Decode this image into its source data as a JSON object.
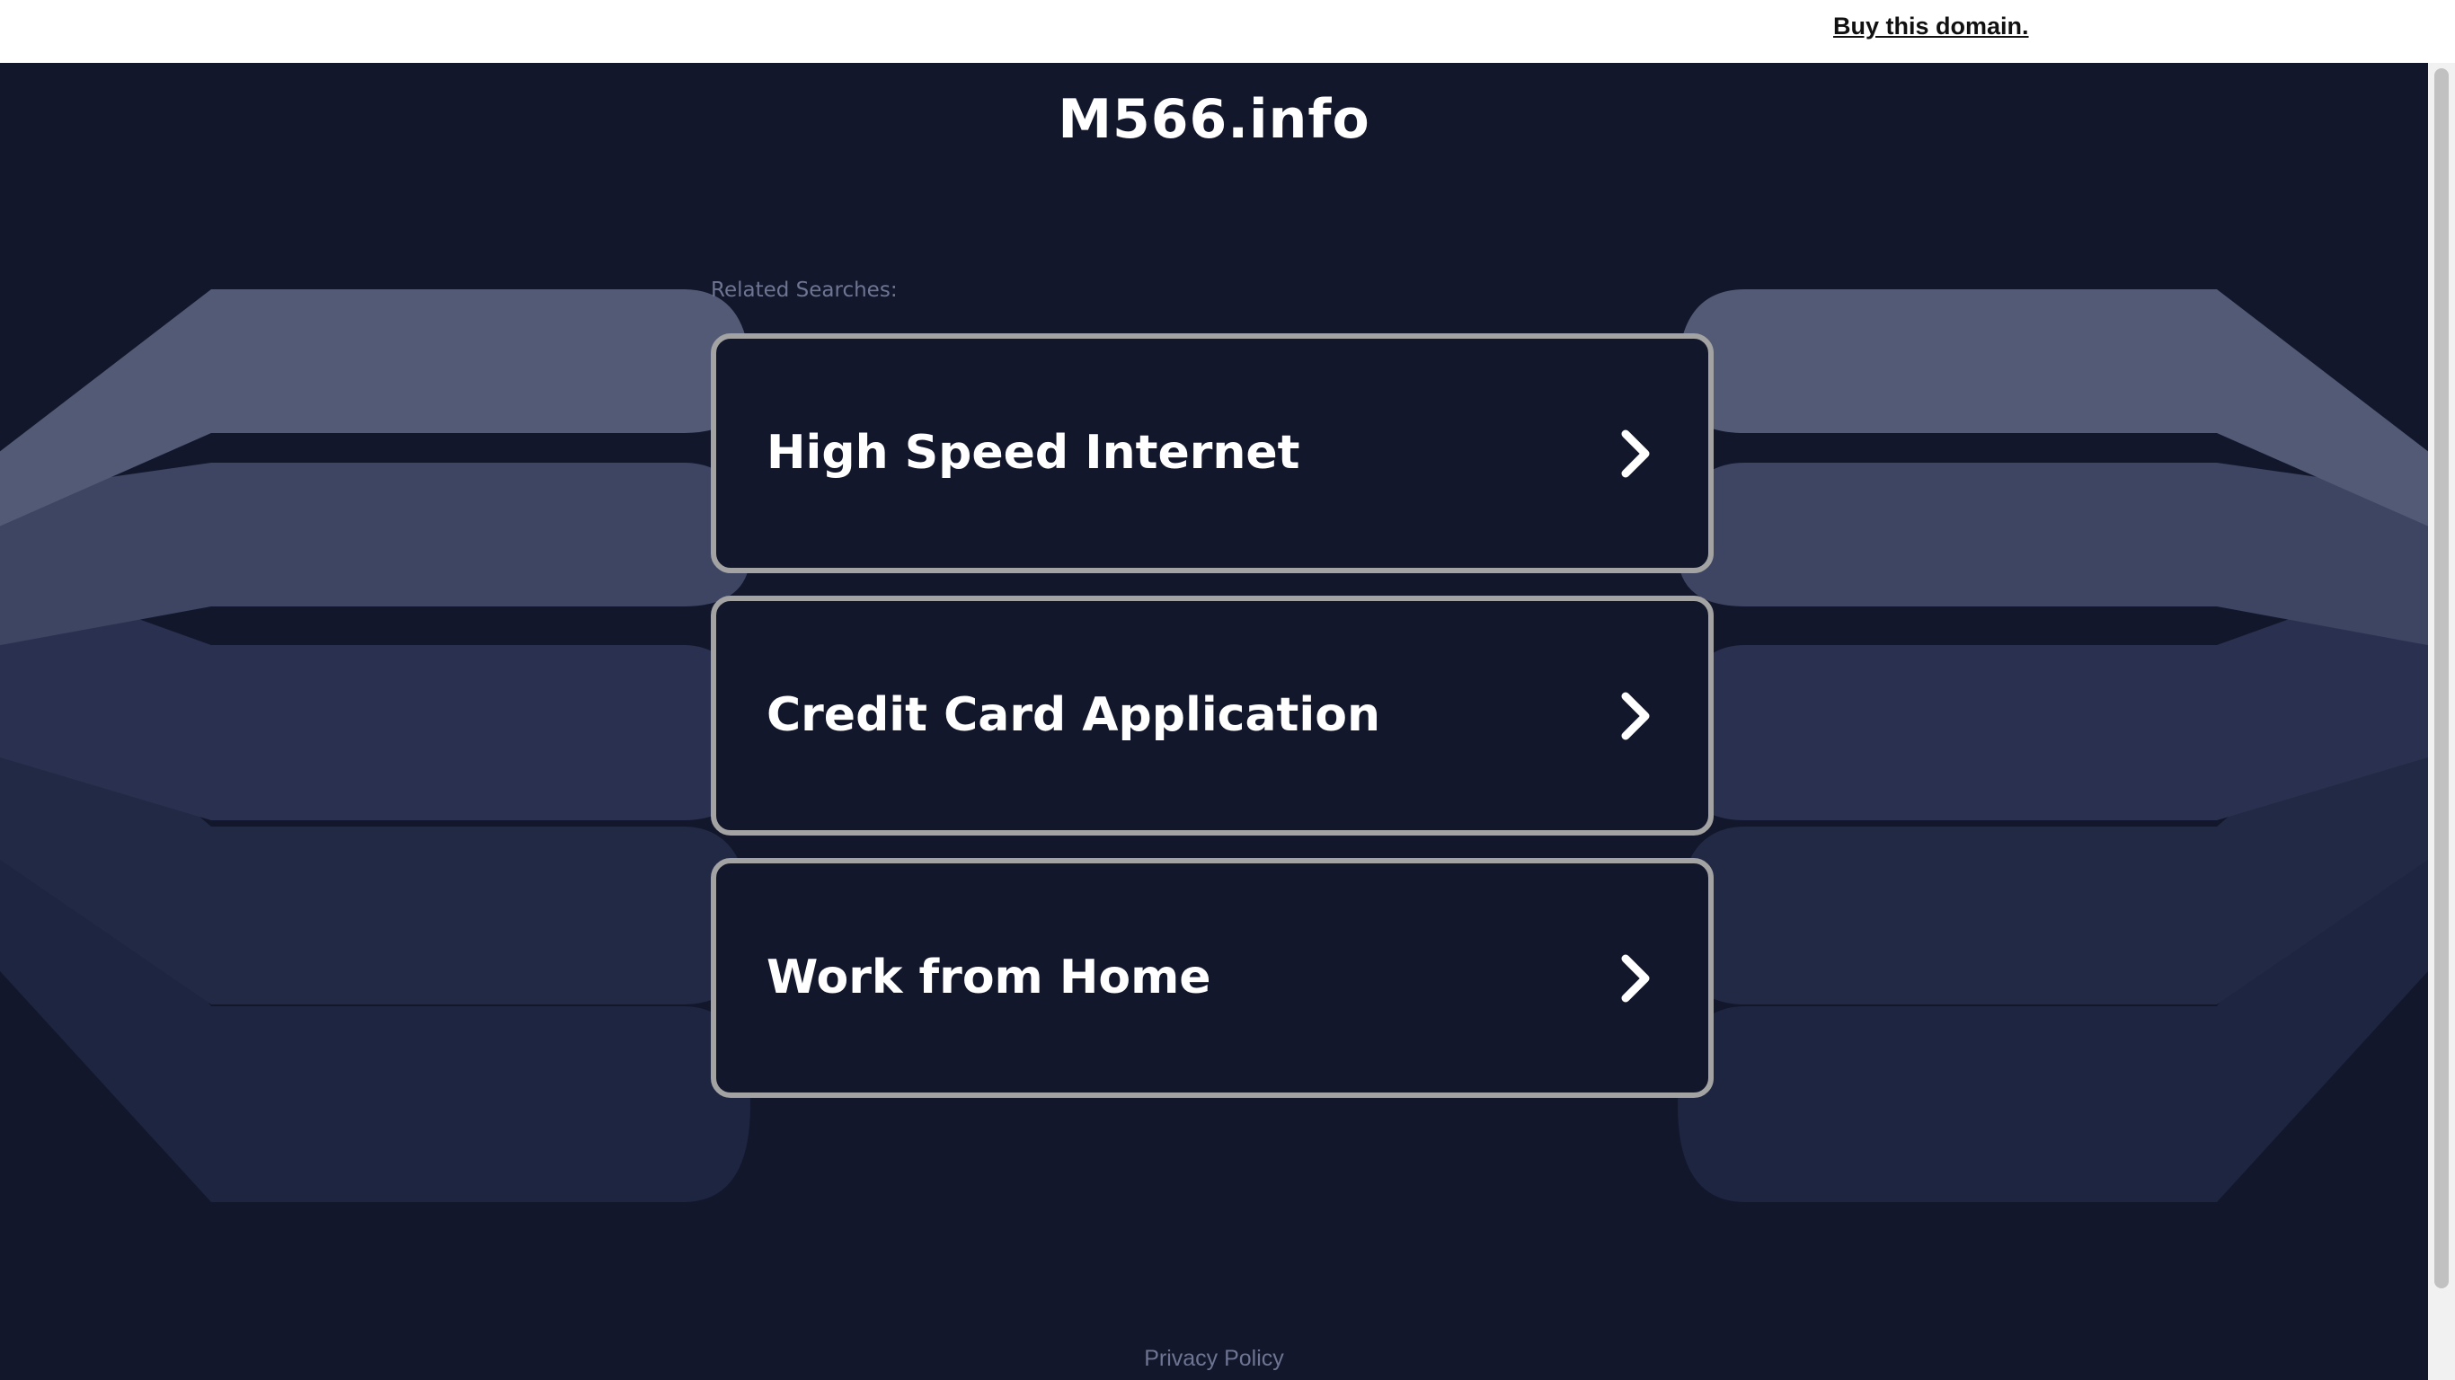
{
  "topbar": {
    "buy_link": "Buy this domain."
  },
  "page": {
    "title": "M566.info",
    "related_label": "Related Searches:"
  },
  "results": [
    {
      "label": "High Speed Internet"
    },
    {
      "label": "Credit Card Application"
    },
    {
      "label": "Work from Home"
    }
  ],
  "footer": {
    "privacy": "Privacy Policy"
  },
  "icons": {
    "result_arrow": "chevron-right-icon"
  },
  "colors": {
    "background": "#12172b",
    "card_border": "#a3a3a3",
    "muted_text": "#6e7592",
    "bg_shape_1": "#525a76",
    "bg_shape_2": "#3d4563",
    "bg_shape_3": "#2a3150",
    "bg_shape_4": "#222945",
    "bg_shape_5": "#1e2541"
  }
}
